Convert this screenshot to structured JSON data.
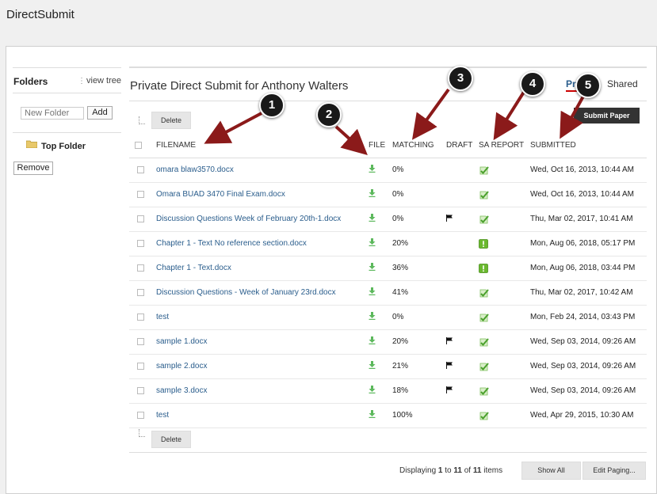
{
  "app": {
    "title": "DirectSubmit"
  },
  "sidebar": {
    "title": "Folders",
    "view_tree_label": "view tree",
    "new_folder_placeholder": "New Folder",
    "add_label": "Add",
    "tree_item_label": "Top Folder",
    "remove_label": "Remove"
  },
  "main": {
    "title": "Private Direct Submit for Anthony Walters",
    "tabs": [
      {
        "label": "Pri"
      },
      {
        "label": "Shared"
      }
    ],
    "submit_label": "Submit Paper",
    "delete_label": "Delete",
    "columns": [
      "FILENAME",
      "FILE",
      "MATCHING",
      "DRAFT",
      "SA REPORT",
      "SUBMITTED"
    ]
  },
  "files": [
    {
      "name": "omara blaw3570.docx",
      "matching": "0%",
      "draft": false,
      "sa": "ok",
      "submitted": "Wed, Oct 16, 2013, 10:44 AM"
    },
    {
      "name": "Omara BUAD 3470 Final Exam.docx",
      "matching": "0%",
      "draft": false,
      "sa": "ok",
      "submitted": "Wed, Oct 16, 2013, 10:44 AM"
    },
    {
      "name": "Discussion Questions Week of February 20th-1.docx",
      "matching": "0%",
      "draft": true,
      "sa": "ok",
      "submitted": "Thu, Mar 02, 2017, 10:41 AM"
    },
    {
      "name": "Chapter 1 - Text No reference section.docx",
      "matching": "20%",
      "draft": false,
      "sa": "warn",
      "submitted": "Mon, Aug 06, 2018, 05:17 PM"
    },
    {
      "name": "Chapter 1 - Text.docx",
      "matching": "36%",
      "draft": false,
      "sa": "warn",
      "submitted": "Mon, Aug 06, 2018, 03:44 PM"
    },
    {
      "name": "Discussion Questions - Week of January 23rd.docx",
      "matching": "41%",
      "draft": false,
      "sa": "ok",
      "submitted": "Thu, Mar 02, 2017, 10:42 AM"
    },
    {
      "name": "test",
      "matching": "0%",
      "draft": false,
      "sa": "ok",
      "submitted": "Mon, Feb 24, 2014, 03:43 PM"
    },
    {
      "name": "sample 1.docx",
      "matching": "20%",
      "draft": true,
      "sa": "ok",
      "submitted": "Wed, Sep 03, 2014, 09:26 AM"
    },
    {
      "name": "sample 2.docx",
      "matching": "21%",
      "draft": true,
      "sa": "ok",
      "submitted": "Wed, Sep 03, 2014, 09:26 AM"
    },
    {
      "name": "sample 3.docx",
      "matching": "18%",
      "draft": true,
      "sa": "ok",
      "submitted": "Wed, Sep 03, 2014, 09:26 AM"
    },
    {
      "name": "test",
      "matching": "100%",
      "draft": false,
      "sa": "ok",
      "submitted": "Wed, Apr 29, 2015, 10:30 AM"
    }
  ],
  "paging": {
    "prefix": "Displaying",
    "from": "1",
    "to_word": "to",
    "to": "11",
    "of_word": "of",
    "total": "11",
    "suffix": "items",
    "show_all_label": "Show All",
    "edit_paging_label": "Edit Paging..."
  },
  "callouts": [
    "1",
    "2",
    "3",
    "4",
    "5"
  ],
  "colors": {
    "link": "#2a5d8c",
    "download": "#5cb85c",
    "sa_ok": "#5cb85c",
    "sa_warn": "#6ab82e",
    "arrow": "#8b1a1a",
    "tab_accent": "#cc0000"
  },
  "icons": {
    "download": "download-icon",
    "draft": "flag-icon",
    "sa_ok": "check-report-icon",
    "sa_warn": "alert-report-icon",
    "folder": "folder-icon"
  }
}
